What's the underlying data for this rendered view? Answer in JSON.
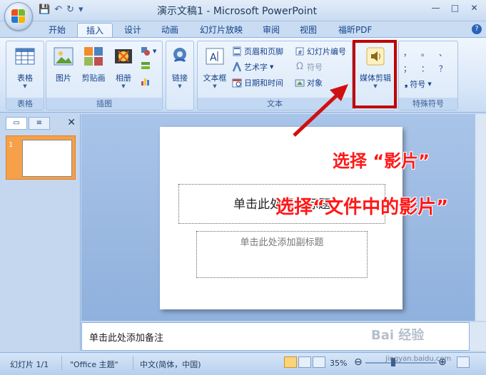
{
  "window": {
    "title": "演示文稿1 - Microsoft PowerPoint",
    "minimize": "—",
    "maximize": "□",
    "close": "✕"
  },
  "qat": {
    "save": "💾",
    "undo": "↶",
    "redo": "↻",
    "more": "▾"
  },
  "tabs": [
    {
      "label": "开始"
    },
    {
      "label": "插入"
    },
    {
      "label": "设计"
    },
    {
      "label": "动画"
    },
    {
      "label": "幻灯片放映"
    },
    {
      "label": "审阅"
    },
    {
      "label": "视图"
    },
    {
      "label": "福昕PDF"
    }
  ],
  "help": "?",
  "ribbon": {
    "tables": {
      "button": "表格",
      "group": "表格"
    },
    "illustrations": {
      "picture": "图片",
      "clipart": "剪贴画",
      "album": "相册",
      "group": "插图"
    },
    "links": {
      "button": "链接"
    },
    "text": {
      "textbox": "文本框",
      "header_footer": "页眉和页脚",
      "wordart": "艺术字",
      "datetime": "日期和时间",
      "slide_number": "幻灯片编号",
      "symbol": "符号",
      "object": "对象",
      "group": "文本"
    },
    "media": {
      "button": "媒体剪辑"
    },
    "special": {
      "chars": [
        "，",
        "。",
        "、",
        "；",
        "：",
        "？"
      ],
      "symbol": "符号",
      "group": "特殊符号"
    }
  },
  "left_pane": {
    "slide_number": "1",
    "close": "✕"
  },
  "slide": {
    "title_placeholder": "单击此处添加标题",
    "subtitle_placeholder": "单击此处添加副标题"
  },
  "annotations": {
    "step1": "选择 “影片”",
    "step2": "选择“文件中的影片”"
  },
  "notes": {
    "placeholder": "单击此处添加备注"
  },
  "status": {
    "slide_info": "幻灯片 1/1",
    "theme": "\"Office 主题\"",
    "language": "中文(简体，中国)",
    "zoom": "35%",
    "minus": "⊖",
    "plus": "⊕"
  },
  "watermark": {
    "brand": "Bai 经验",
    "url": "jingyan.baidu.com"
  },
  "colors": {
    "annotation_red": "#ff1818",
    "highlight_box": "#c00000",
    "selected_thumb": "#f6a04a"
  }
}
